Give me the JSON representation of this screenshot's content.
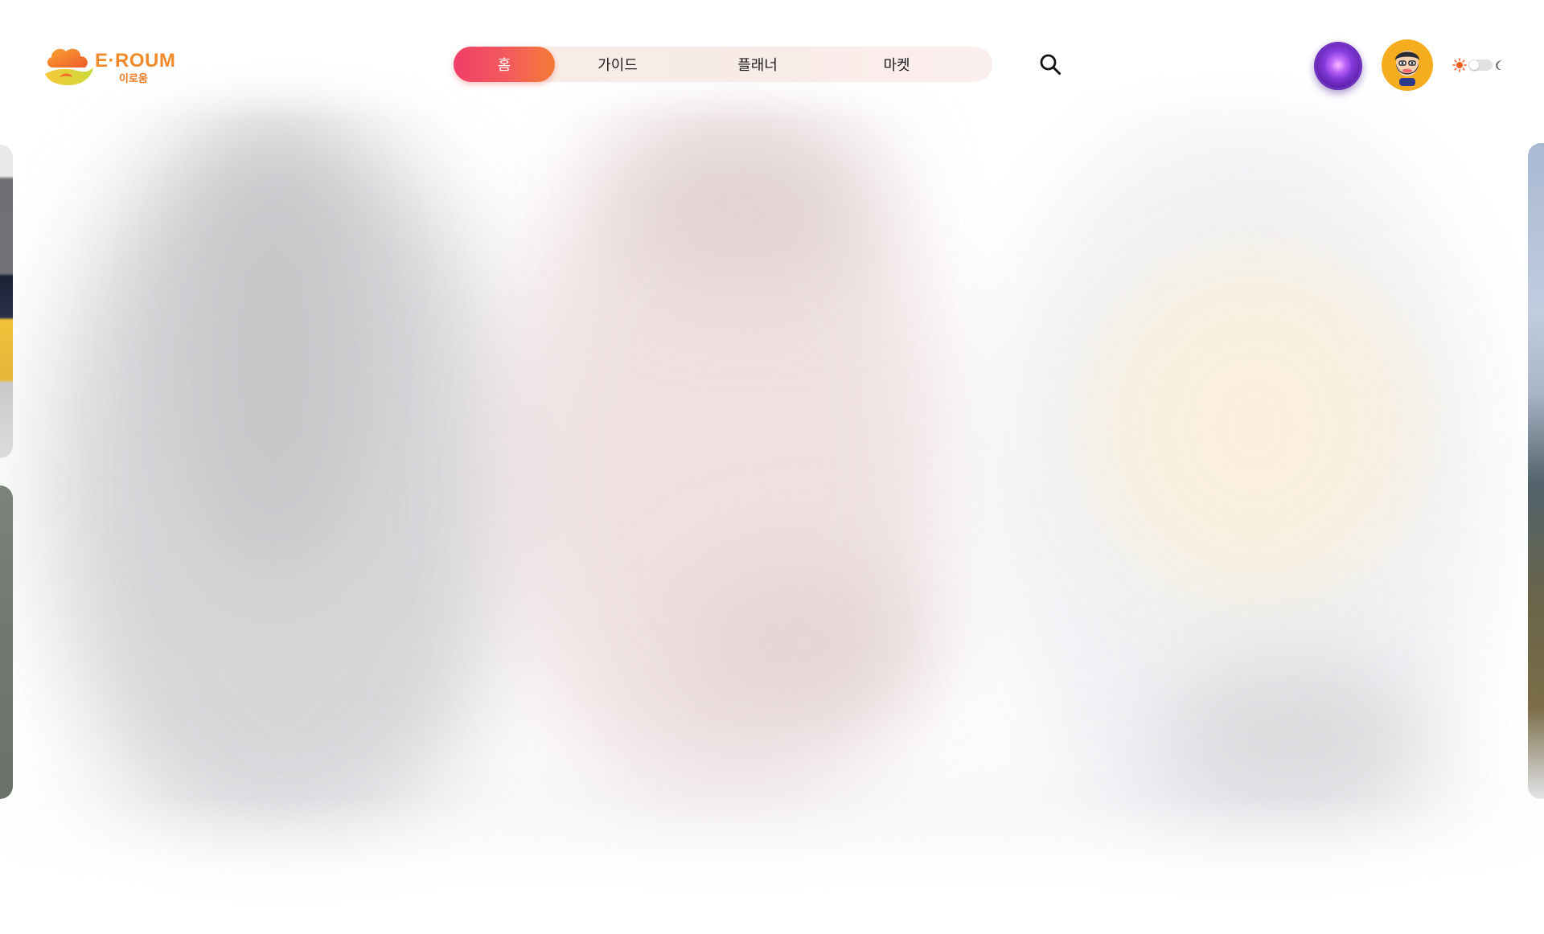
{
  "brand": {
    "name": "E·ROUM",
    "name_ko": "이로움",
    "primary_color": "#f08a2b"
  },
  "nav": {
    "items": [
      {
        "label": "홈",
        "active": true
      },
      {
        "label": "가이드",
        "active": false
      },
      {
        "label": "플래너",
        "active": false
      },
      {
        "label": "마켓",
        "active": false
      }
    ],
    "active_gradient": [
      "#ef3f68",
      "#f47c35"
    ]
  },
  "header": {
    "search_icon": "search-icon",
    "assistant_icon": "ai-orb-icon",
    "avatar_icon": "user-avatar",
    "theme": {
      "sun_icon": "sun-icon",
      "moon_icon": "moon-icon",
      "mode": "light"
    }
  },
  "carousel": {
    "state": "loading",
    "slides_visible": 3
  }
}
